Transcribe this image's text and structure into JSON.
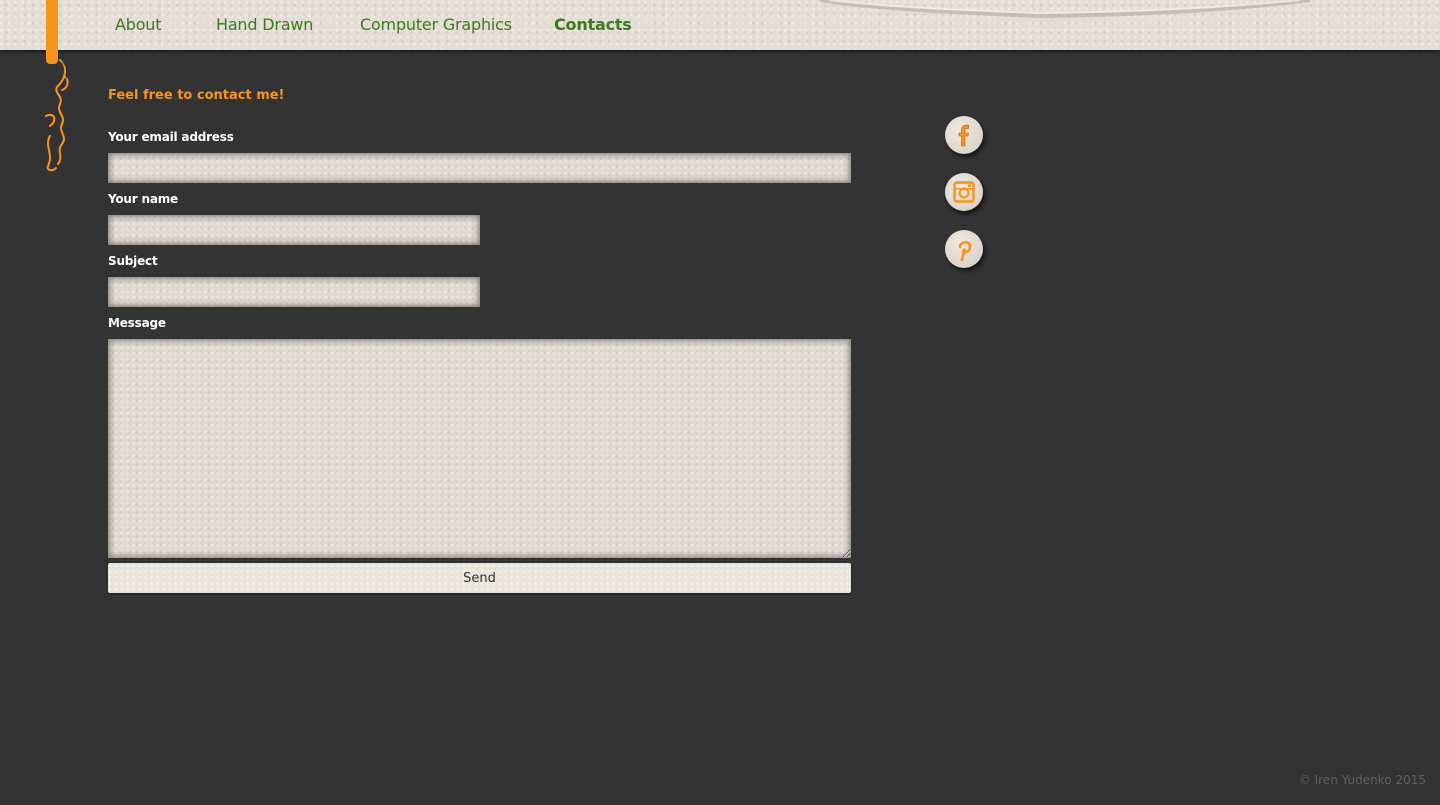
{
  "nav": {
    "items": [
      {
        "label": "About",
        "active": false
      },
      {
        "label": "Hand Drawn",
        "active": false
      },
      {
        "label": "Computer Graphics",
        "active": false
      },
      {
        "label": "Contacts",
        "active": true
      }
    ]
  },
  "logo": {
    "text": "Iren Yudenko",
    "icon": "signature-logo"
  },
  "contact": {
    "lead": "Feel free to contact me!",
    "email_label": "Your email address",
    "email_value": "",
    "name_label": "Your name",
    "name_value": "",
    "subject_label": "Subject",
    "subject_value": "",
    "message_label": "Message",
    "message_value": "",
    "send_label": "Send"
  },
  "social": [
    {
      "name": "facebook",
      "icon": "facebook-icon"
    },
    {
      "name": "instagram",
      "icon": "instagram-icon"
    },
    {
      "name": "pinterest",
      "icon": "pinterest-icon"
    }
  ],
  "footer": {
    "copyright": "© Iren Yudenko 2015"
  },
  "colors": {
    "background": "#333333",
    "accent_orange": "#f7941d",
    "nav_green": "#3d7a1b",
    "paper": "#e3ddd4"
  }
}
